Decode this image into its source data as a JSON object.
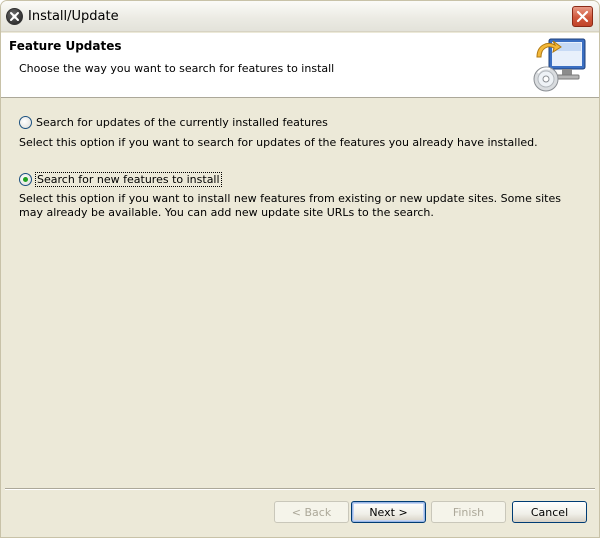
{
  "window": {
    "title": "Install/Update",
    "title_icon": "eclipse-logo-icon",
    "close_icon": "close-icon"
  },
  "header": {
    "title": "Feature Updates",
    "description": "Choose the way you want to search for features to install",
    "image_icon": "monitor-cd-update-icon"
  },
  "options": [
    {
      "label": "Search for updates of the currently installed features",
      "description": "Select this option if you want to search for updates of the features you already have installed.",
      "selected": false
    },
    {
      "label": "Search for new features to install",
      "description": "Select this option if you want to install new features from existing or new update sites. Some sites may already be available. You can add new update site URLs to the search.",
      "selected": true
    }
  ],
  "buttons": {
    "back": "< Back",
    "next": "Next >",
    "finish": "Finish",
    "cancel": "Cancel"
  },
  "colors": {
    "dialog_bg": "#ece9d8",
    "header_bg": "#ffffff",
    "radio_dot": "#21a121",
    "close_button": "#d0583c"
  }
}
